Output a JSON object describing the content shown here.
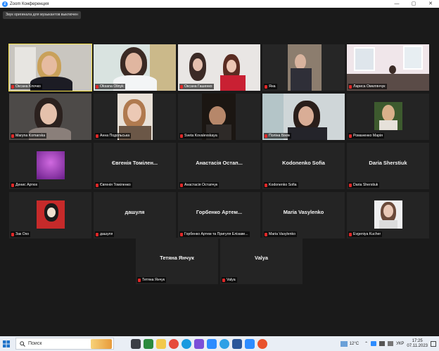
{
  "window": {
    "title": "Zoom Конференция",
    "controls": [
      "—",
      "▢",
      "✕"
    ]
  },
  "notice": "Звук оригинала для музыкантов выключен",
  "participants": [
    {
      "display_name": "",
      "caption": "Оксана Клочко",
      "video": "lady-blond",
      "active": true
    },
    {
      "display_name": "",
      "caption": "Oksana Olinyk",
      "video": "lady-dark"
    },
    {
      "display_name": "",
      "caption": "Оксана Гашенко",
      "video": "two-girls"
    },
    {
      "display_name": "",
      "caption": "Яна",
      "video": "room-dark"
    },
    {
      "display_name": "",
      "caption": "Лариса Омелянчук",
      "video": "classroom"
    },
    {
      "display_name": "",
      "caption": "Maryna Komarska",
      "video": "girl-a"
    },
    {
      "display_name": "",
      "caption": "Анна Подольська",
      "video": "girl-b"
    },
    {
      "display_name": "",
      "caption": "Sveta Kovalevskaya",
      "video": "girl-c"
    },
    {
      "display_name": "",
      "caption": "Поліна Біняк",
      "video": "girl-d"
    },
    {
      "display_name": "",
      "caption": "Романенко Марія",
      "video": "photo-a"
    },
    {
      "display_name": "",
      "caption": "Денис Артюх",
      "video": "purple-avatar"
    },
    {
      "display_name": "Євгенія Томілен...",
      "caption": "Євгенія Томіленко"
    },
    {
      "display_name": "Анастасія Остап...",
      "caption": "Анастасія Остапчук"
    },
    {
      "display_name": "Kodonenko Sofia",
      "caption": "Kodonenko Sofia"
    },
    {
      "display_name": "Daria Sherstiuk",
      "caption": "Daria Sherstiuk"
    },
    {
      "display_name": "",
      "caption": "Зак Охо",
      "video": "red-avatar"
    },
    {
      "display_name": "дашуля",
      "caption": "дашуля"
    },
    {
      "display_name": "Горбенко  Артем...",
      "caption": "Горбенко Артем та Пригуля Елізаве..."
    },
    {
      "display_name": "Maria Vasylenko",
      "caption": "Maria Vasylenko"
    },
    {
      "display_name": "",
      "caption": "Evgeniya Kucher",
      "video": "photo-b"
    },
    {
      "display_name": "Тетяна Янчук",
      "caption": "Тетяна Янчук"
    },
    {
      "display_name": "Valya",
      "caption": "Valya"
    }
  ],
  "taskbar": {
    "search_placeholder": "Поиск",
    "weather": "12°C",
    "lang": "УКР",
    "time": "17:25",
    "date": "07.11.2023"
  }
}
